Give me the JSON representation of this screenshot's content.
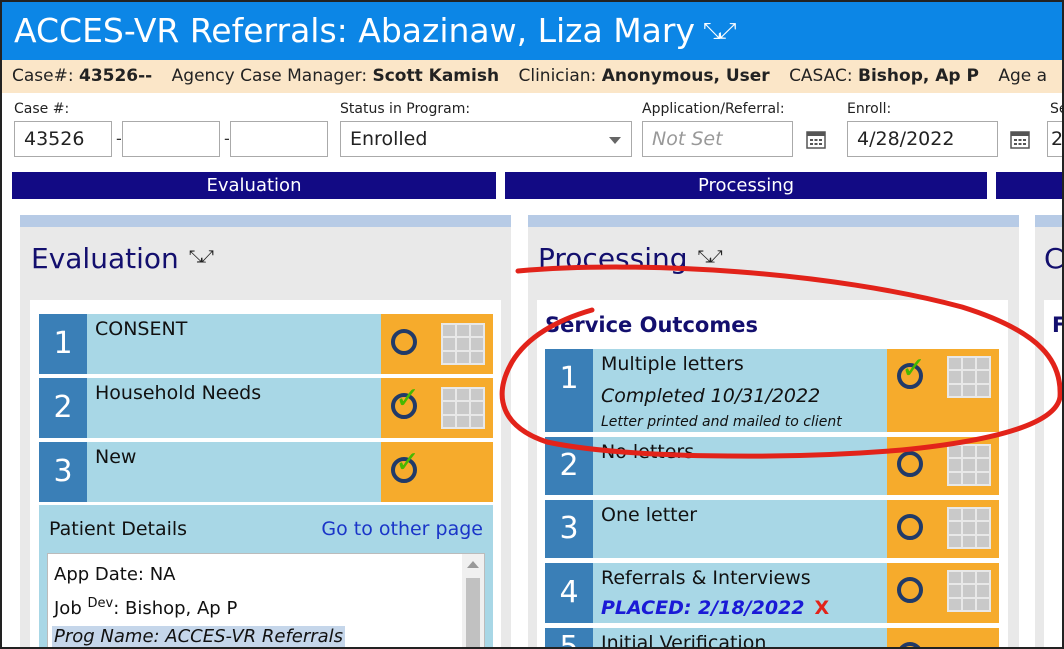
{
  "title": {
    "text": "ACCES-VR Referrals: Abazinaw, Liza Mary",
    "expand_icon": "expand-collapse-icon"
  },
  "info": {
    "case_label": "Case#:",
    "case_value": "43526--",
    "manager_label": "Agency Case Manager:",
    "manager_value": "Scott Kamish",
    "clinician_label": "Clinician:",
    "clinician_value": "Anonymous, User",
    "casac_label": "CASAC:",
    "casac_value": "Bishop, Ap P",
    "age_label": "Age a"
  },
  "fields": {
    "case_label": "Case #:",
    "case_part1": "43526",
    "case_part2": "",
    "case_part3": "",
    "status_label": "Status in Program:",
    "status_value": "Enrolled",
    "app_label": "Application/Referral:",
    "app_placeholder": "Not Set",
    "enroll_label": "Enroll:",
    "enroll_value": "4/28/2022",
    "next_label": "Se",
    "next_value": "2"
  },
  "phases": [
    "Evaluation",
    "Processing",
    ""
  ],
  "evaluation": {
    "heading": "Evaluation",
    "tasks": [
      {
        "num": "1",
        "label": "CONSENT",
        "status": "incomplete"
      },
      {
        "num": "2",
        "label": "Household Needs",
        "status": "complete"
      },
      {
        "num": "3",
        "label": "New",
        "status": "complete"
      }
    ],
    "patient_details": {
      "title": "Patient Details",
      "link": "Go to other page",
      "line1": "App Date: NA",
      "line2_pre": "Job",
      "line2_sup": "Dev",
      "line2_post": ": Bishop, Ap P",
      "line3": "Prog Name: ACCES-VR Referrals"
    }
  },
  "processing": {
    "heading": "Processing",
    "section": "Service Outcomes",
    "tasks": [
      {
        "num": "1",
        "label": "Multiple letters",
        "sub": "Completed 10/31/2022",
        "note": "Letter printed and mailed to client",
        "status": "complete"
      },
      {
        "num": "2",
        "label": "No letters",
        "status": "incomplete"
      },
      {
        "num": "3",
        "label": "One letter",
        "status": "incomplete"
      },
      {
        "num": "4",
        "label": "Referrals & Interviews",
        "placed": "PLACED: 2/18/2022",
        "remove": "X",
        "status": "incomplete"
      },
      {
        "num": "5",
        "label": "Initial Verification",
        "status": "incomplete"
      }
    ]
  },
  "third_col": {
    "heading": "C",
    "section": "F"
  },
  "colors": {
    "title_bar": "#0c86e6",
    "phase_bar": "#120a84",
    "task_blue": "#a8d7e6",
    "task_orange": "#f6ab2c",
    "annotation_red": "#e2231a"
  }
}
